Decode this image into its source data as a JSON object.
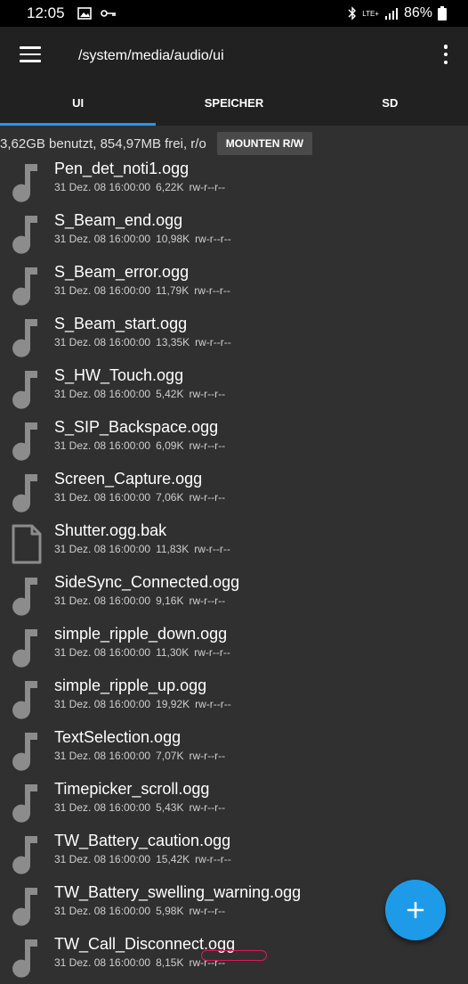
{
  "status": {
    "time": "12:05",
    "network": "LTE+",
    "battery": "86%"
  },
  "appbar": {
    "path": "/system/media/audio/ui",
    "menu_icon": "hamburger-menu-icon",
    "overflow_icon": "more-vert-icon"
  },
  "tabs": [
    {
      "label": "UI",
      "active": true
    },
    {
      "label": "SPEICHER",
      "active": false
    },
    {
      "label": "SD",
      "active": false
    }
  ],
  "storage": {
    "text": "3,62GB benutzt, 854,97MB frei, r/o",
    "mount_label": "MOUNTEN R/W"
  },
  "files": [
    {
      "name": "Pen_det_noti1.ogg",
      "date": "31 Dez. 08 16:00:00",
      "size": "6,22K",
      "perms": "rw-r--r--",
      "icon": "music-note"
    },
    {
      "name": "S_Beam_end.ogg",
      "date": "31 Dez. 08 16:00:00",
      "size": "10,98K",
      "perms": "rw-r--r--",
      "icon": "music-note"
    },
    {
      "name": "S_Beam_error.ogg",
      "date": "31 Dez. 08 16:00:00",
      "size": "11,79K",
      "perms": "rw-r--r--",
      "icon": "music-note"
    },
    {
      "name": "S_Beam_start.ogg",
      "date": "31 Dez. 08 16:00:00",
      "size": "13,35K",
      "perms": "rw-r--r--",
      "icon": "music-note"
    },
    {
      "name": "S_HW_Touch.ogg",
      "date": "31 Dez. 08 16:00:00",
      "size": "5,42K",
      "perms": "rw-r--r--",
      "icon": "music-note"
    },
    {
      "name": "S_SIP_Backspace.ogg",
      "date": "31 Dez. 08 16:00:00",
      "size": "6,09K",
      "perms": "rw-r--r--",
      "icon": "music-note"
    },
    {
      "name": "Screen_Capture.ogg",
      "date": "31 Dez. 08 16:00:00",
      "size": "7,06K",
      "perms": "rw-r--r--",
      "icon": "music-note"
    },
    {
      "name": "Shutter.ogg.bak",
      "date": "31 Dez. 08 16:00:00",
      "size": "11,83K",
      "perms": "rw-r--r--",
      "icon": "file"
    },
    {
      "name": "SideSync_Connected.ogg",
      "date": "31 Dez. 08 16:00:00",
      "size": "9,16K",
      "perms": "rw-r--r--",
      "icon": "music-note"
    },
    {
      "name": "simple_ripple_down.ogg",
      "date": "31 Dez. 08 16:00:00",
      "size": "11,30K",
      "perms": "rw-r--r--",
      "icon": "music-note"
    },
    {
      "name": "simple_ripple_up.ogg",
      "date": "31 Dez. 08 16:00:00",
      "size": "19,92K",
      "perms": "rw-r--r--",
      "icon": "music-note"
    },
    {
      "name": "TextSelection.ogg",
      "date": "31 Dez. 08 16:00:00",
      "size": "7,07K",
      "perms": "rw-r--r--",
      "icon": "music-note"
    },
    {
      "name": "Timepicker_scroll.ogg",
      "date": "31 Dez. 08 16:00:00",
      "size": "5,43K",
      "perms": "rw-r--r--",
      "icon": "music-note"
    },
    {
      "name": "TW_Battery_caution.ogg",
      "date": "31 Dez. 08 16:00:00",
      "size": "15,42K",
      "perms": "rw-r--r--",
      "icon": "music-note"
    },
    {
      "name": "TW_Battery_swelling_warning.ogg",
      "date": "31 Dez. 08 16:00:00",
      "size": "5,98K",
      "perms": "rw-r--r--",
      "icon": "music-note"
    },
    {
      "name": "TW_Call_Disconnect.ogg",
      "date": "31 Dez. 08 16:00:00",
      "size": "8,15K",
      "perms": "rw-r--r--",
      "icon": "music-note"
    }
  ],
  "fab": {
    "icon": "plus-icon"
  },
  "colors": {
    "accent": "#2196f3",
    "fab": "#1e9be8",
    "background": "#303030",
    "appbar": "#212121"
  }
}
